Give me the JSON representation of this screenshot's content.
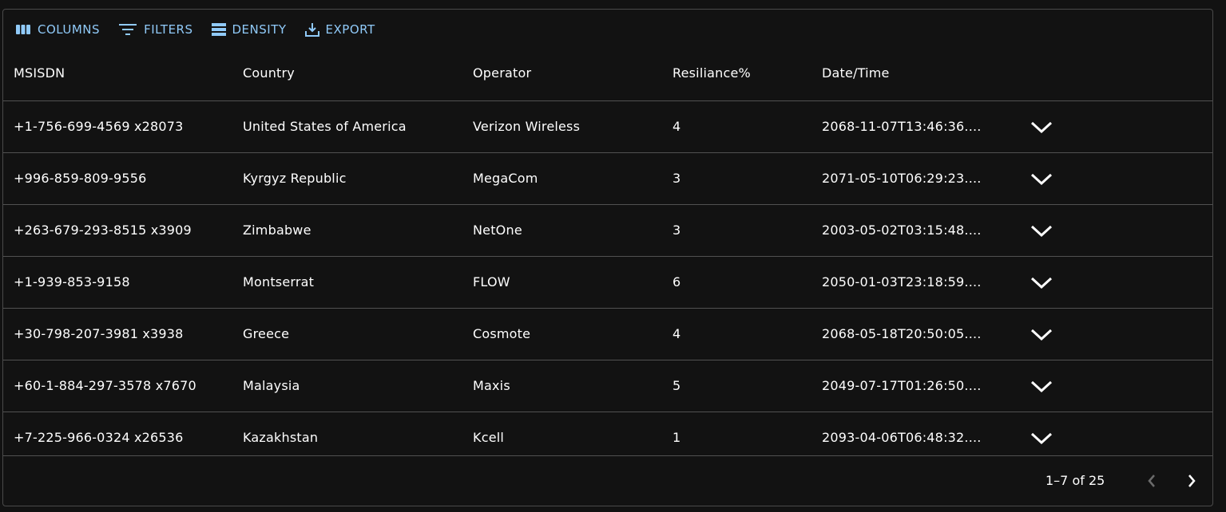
{
  "toolbar": {
    "columns_label": "COLUMNS",
    "filters_label": "FILTERS",
    "density_label": "DENSITY",
    "export_label": "EXPORT"
  },
  "columns": [
    "MSISDN",
    "Country",
    "Operator",
    "Resiliance%",
    "Date/Time"
  ],
  "rows": [
    {
      "msisdn": "+1-756-699-4569 x28073",
      "country": "United States of America",
      "operator": "Verizon Wireless",
      "resiliance": "4",
      "datetime": "2068-11-07T13:46:36...."
    },
    {
      "msisdn": "+996-859-809-9556",
      "country": "Kyrgyz Republic",
      "operator": "MegaCom",
      "resiliance": "3",
      "datetime": "2071-05-10T06:29:23...."
    },
    {
      "msisdn": "+263-679-293-8515 x3909",
      "country": "Zimbabwe",
      "operator": "NetOne",
      "resiliance": "3",
      "datetime": "2003-05-02T03:15:48...."
    },
    {
      "msisdn": "+1-939-853-9158",
      "country": "Montserrat",
      "operator": "FLOW",
      "resiliance": "6",
      "datetime": "2050-01-03T23:18:59...."
    },
    {
      "msisdn": "+30-798-207-3981 x3938",
      "country": "Greece",
      "operator": "Cosmote",
      "resiliance": "4",
      "datetime": "2068-05-18T20:50:05...."
    },
    {
      "msisdn": "+60-1-884-297-3578 x7670",
      "country": "Malaysia",
      "operator": "Maxis",
      "resiliance": "5",
      "datetime": "2049-07-17T01:26:50...."
    },
    {
      "msisdn": "+7-225-966-0324 x26536",
      "country": "Kazakhstan",
      "operator": "Kcell",
      "resiliance": "1",
      "datetime": "2093-04-06T06:48:32...."
    }
  ],
  "pagination": {
    "text": "1–7 of 25"
  },
  "icons": {
    "columns": "view-column-icon",
    "filters": "filter-list-icon",
    "density": "density-icon",
    "export": "download-icon",
    "expand": "chevron-down-icon",
    "prev": "chevron-left-icon",
    "next": "chevron-right-icon"
  },
  "colors": {
    "background": "#121212",
    "accent": "#90caf9",
    "divider": "#515151",
    "text": "#ffffff",
    "disabled": "#6b6b6b"
  }
}
